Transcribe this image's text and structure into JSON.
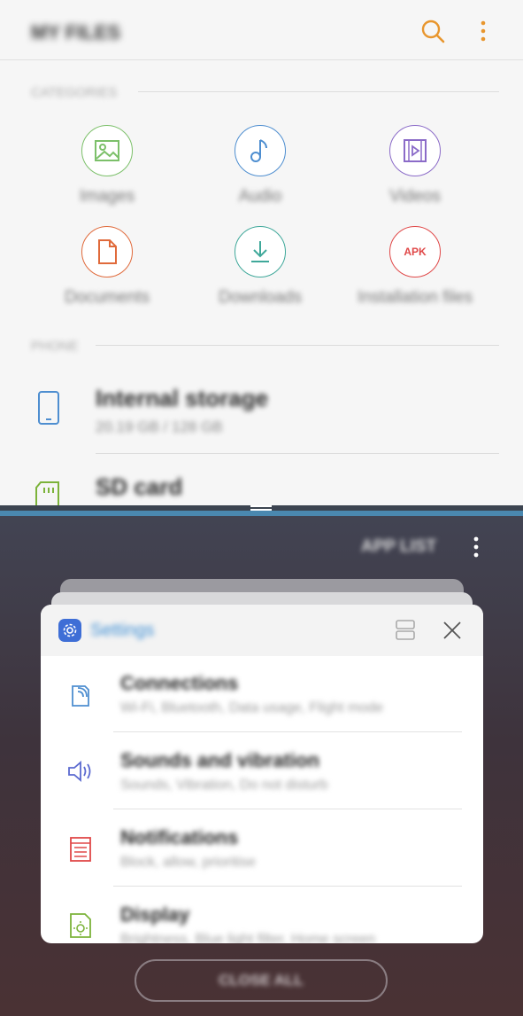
{
  "myfiles": {
    "title": "MY FILES",
    "icons": {
      "search": "search-icon",
      "more": "more-options-icon"
    },
    "categories_label": "CATEGORIES",
    "categories": [
      {
        "label": "Images",
        "icon": "image-icon",
        "color": "#7cc06a"
      },
      {
        "label": "Audio",
        "icon": "music-note-icon",
        "color": "#4e8ed0"
      },
      {
        "label": "Videos",
        "icon": "video-icon",
        "color": "#8b6bc8"
      },
      {
        "label": "Documents",
        "icon": "document-icon",
        "color": "#e06a3b"
      },
      {
        "label": "Downloads",
        "icon": "download-icon",
        "color": "#3fa89a"
      },
      {
        "label": "Installation files",
        "icon": "apk-icon",
        "color": "#e04848",
        "badge": "APK"
      }
    ],
    "phone_label": "PHONE",
    "storage": [
      {
        "title": "Internal storage",
        "subtitle": "20.19 GB / 128 GB",
        "icon": "phone-icon"
      },
      {
        "title": "SD card",
        "subtitle": "",
        "icon": "sd-card-icon"
      }
    ],
    "accent_color": "#e8962e"
  },
  "recents": {
    "app_list_label": "APP LIST",
    "card": {
      "app_name": "Settings",
      "app_icon": "gear-icon",
      "rows": [
        {
          "title": "Connections",
          "subtitle": "Wi-Fi, Bluetooth, Data usage, Flight mode",
          "icon": "connections-icon",
          "color": "#4e8ed0"
        },
        {
          "title": "Sounds and vibration",
          "subtitle": "Sounds, Vibration, Do not disturb",
          "icon": "speaker-icon",
          "color": "#5b6ad0"
        },
        {
          "title": "Notifications",
          "subtitle": "Block, allow, prioritise",
          "icon": "notifications-icon",
          "color": "#e04848"
        },
        {
          "title": "Display",
          "subtitle": "Brightness, Blue light filter, Home screen",
          "icon": "display-icon",
          "color": "#7cb33a"
        }
      ]
    },
    "close_all_label": "CLOSE ALL"
  }
}
